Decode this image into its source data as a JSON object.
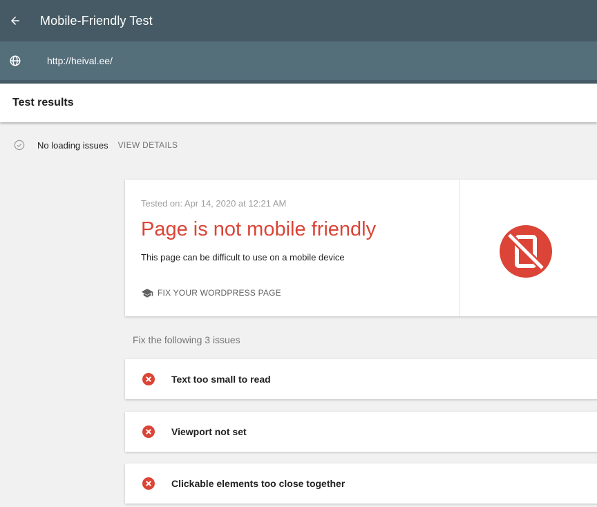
{
  "topbar": {
    "title": "Mobile-Friendly Test",
    "back_icon": "arrow-back-icon"
  },
  "urlbar": {
    "url": "http://heival.ee/",
    "icon": "globe-icon"
  },
  "results": {
    "title": "Test results",
    "loading_status": "No loading issues",
    "view_details": "VIEW DETAILS"
  },
  "card": {
    "tested_on": "Tested on: Apr 14, 2020 at 12:21 AM",
    "verdict": "Page is not mobile friendly",
    "verdict_description": "This page can be difficult to use on a mobile device",
    "fix_link": "FIX YOUR WORDPRESS PAGE",
    "fix_icon": "graduation-cap-icon",
    "status_icon": "mobile-off-icon",
    "verdict_color": "#db4437"
  },
  "issues": {
    "heading": "Fix the following 3 issues",
    "items": [
      {
        "label": "Text too small to read"
      },
      {
        "label": "Viewport not set"
      },
      {
        "label": "Clickable elements too close together"
      }
    ]
  },
  "colors": {
    "topbar": "#455a64",
    "urlbar": "#546e7a",
    "error": "#db4437"
  }
}
